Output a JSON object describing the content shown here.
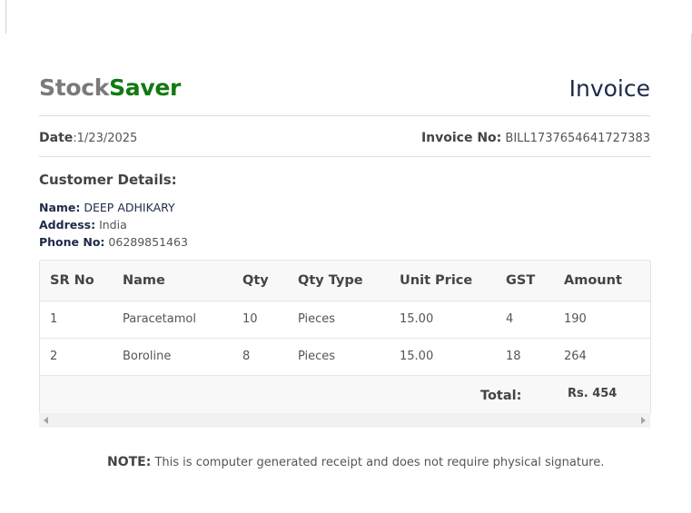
{
  "brand": {
    "part1": "Stock",
    "part2": "Saver",
    "part1_color": "#7a7a7a",
    "part2_color": "#117a11"
  },
  "invoice_title": "Invoice",
  "meta": {
    "date_label": "Date",
    "date_value": ":1/23/2025",
    "invoice_no_label": "Invoice No:",
    "invoice_no_value": "BILL1737654641727383"
  },
  "customer": {
    "heading": "Customer Details:",
    "name_label": "Name:",
    "name_value": "DEEP ADHIKARY",
    "address_label": "Address:",
    "address_value": "India",
    "phone_label": "Phone No:",
    "phone_value": "06289851463"
  },
  "table": {
    "headers": [
      "SR No",
      "Name",
      "Qty",
      "Qty Type",
      "Unit Price",
      "GST",
      "Amount"
    ],
    "rows": [
      [
        "1",
        "Paracetamol",
        "10",
        "Pieces",
        "15.00",
        "4",
        "190"
      ],
      [
        "2",
        "Boroline",
        "8",
        "Pieces",
        "15.00",
        "18",
        "264"
      ]
    ],
    "total_label": "Total:",
    "total_value": "Rs. 454"
  },
  "note": {
    "label": "NOTE:",
    "text": "This is computer generated receipt and does not require physical signature."
  },
  "icons": {
    "scroll_left": "chevron-left-icon",
    "scroll_right": "chevron-right-icon"
  }
}
